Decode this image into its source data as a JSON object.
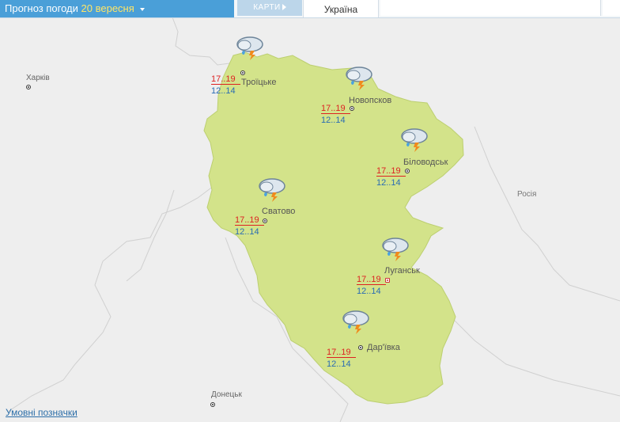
{
  "header": {
    "title_prefix": "Прогноз погоди",
    "title_date": "20 вересня",
    "maps_tab": "КАРТИ",
    "country_tab": "Україна"
  },
  "legend_link": "Умовні позначки",
  "external": {
    "kharkiv": "Харків",
    "donetsk": "Донецьк",
    "russia": "Росія"
  },
  "cities": [
    {
      "name": "Троїцьке",
      "tmax": "17..19",
      "tmin": "12..14",
      "icon": "storm-rain-icon"
    },
    {
      "name": "Новопсков",
      "tmax": "17..19",
      "tmin": "12..14",
      "icon": "storm-rain-icon"
    },
    {
      "name": "Біловодськ",
      "tmax": "17..19",
      "tmin": "12..14",
      "icon": "storm-rain-icon"
    },
    {
      "name": "Сватово",
      "tmax": "17..19",
      "tmin": "12..14",
      "icon": "storm-rain-icon"
    },
    {
      "name": "Луганськ",
      "tmax": "17..19",
      "tmin": "12..14",
      "icon": "storm-rain-icon"
    },
    {
      "name": "Дар'ївка",
      "tmax": "17..19",
      "tmin": "12..14",
      "icon": "storm-rain-icon"
    }
  ],
  "colors": {
    "region_fill": "#d3e38a",
    "background": "#eeeeee",
    "header_blue": "#4a9fd8",
    "date_yellow": "#ffe566",
    "tmax_red": "#d22222",
    "tmin_blue": "#2a6cb3"
  }
}
